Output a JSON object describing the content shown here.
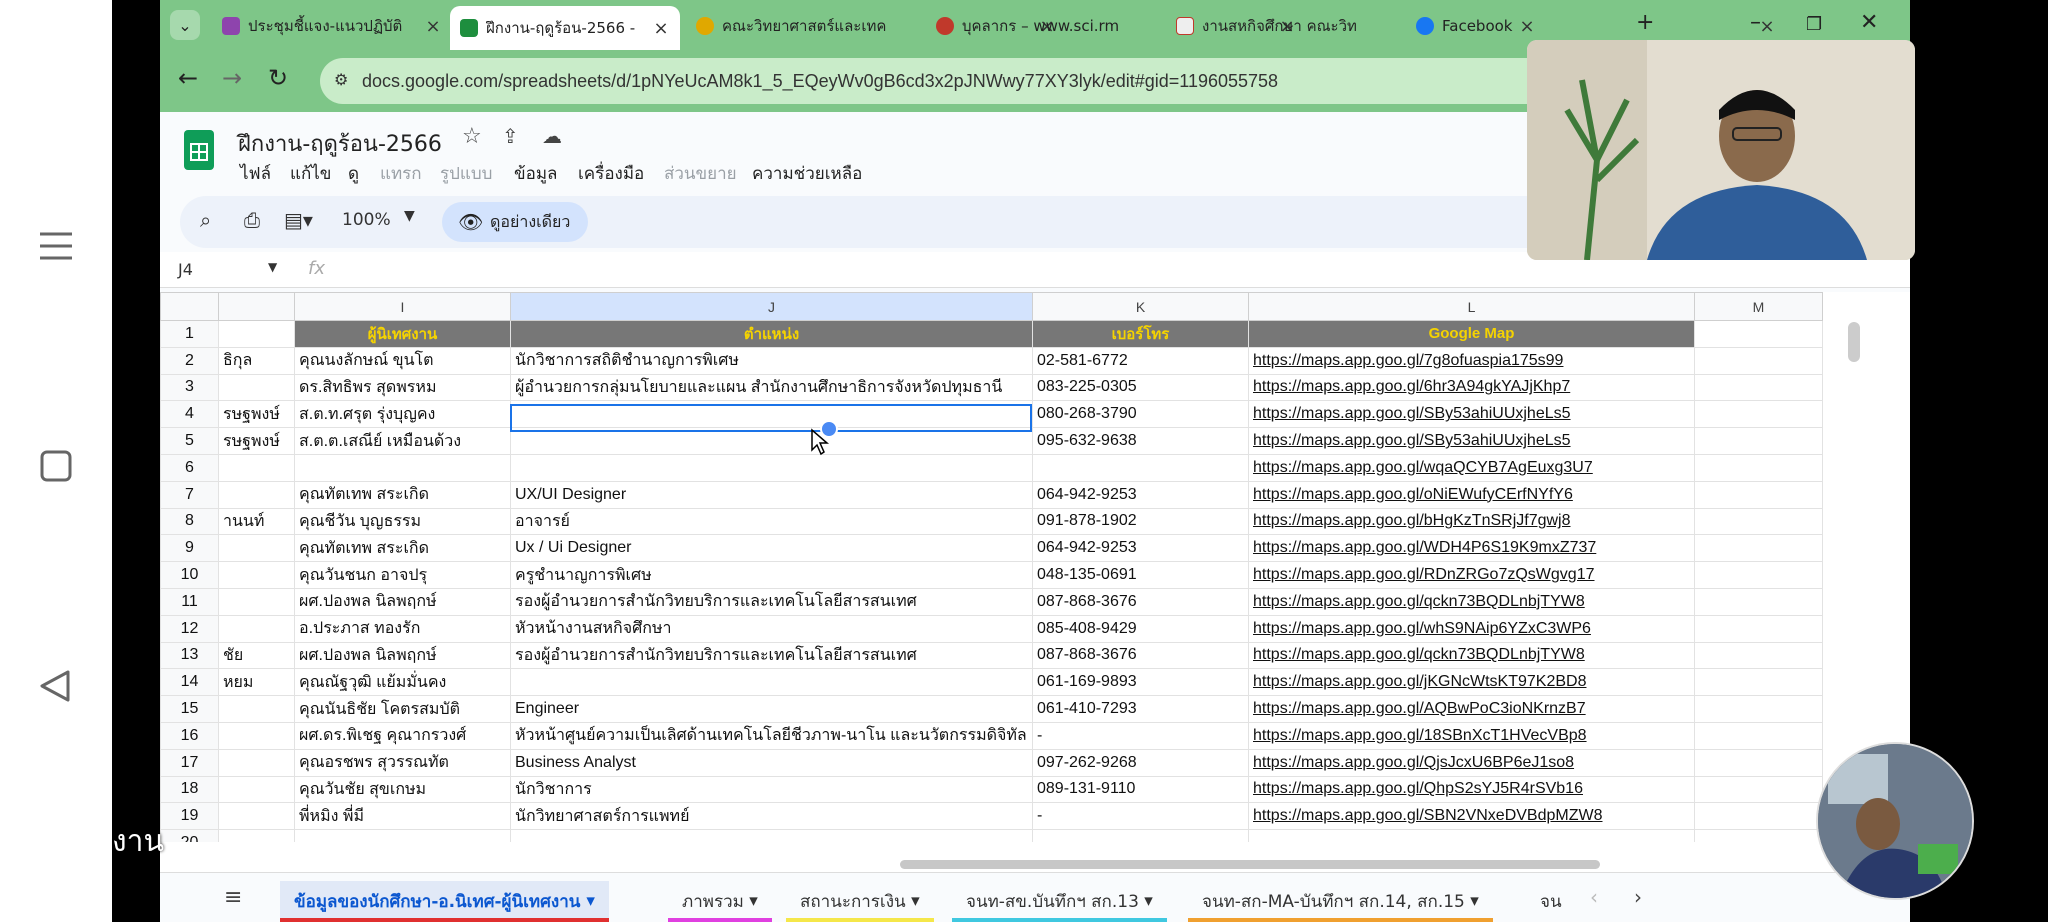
{
  "tabs": [
    "ประชุมชี้แจง-แนวปฏิบัติ",
    "ฝึกงาน-ฤดูร้อน-2566 -",
    "คณะวิทยาศาสตร์และเทค",
    "บุคลากร – www.sci.rm",
    "งานสหกิจศึกษา คณะวิท",
    "Facebook"
  ],
  "url": "docs.google.com/spreadsheets/d/1pNYeUcAM8k1_5_EQeyWv0gB6cd3x2pJNWwy77XY3lyk/edit#gid=1196055758",
  "doc": {
    "title": "ฝึกงาน-ฤดูร้อน-2566",
    "menu": [
      "ไฟล์",
      "แก้ไข",
      "ดู",
      "แทรก",
      "รูปแบบ",
      "ข้อมูล",
      "เครื่องมือ",
      "ส่วนขยาย",
      "ความช่วยเหลือ"
    ],
    "zoom": "100%",
    "view_only": "ดูอย่างเดียว",
    "namebox": "J4"
  },
  "columns": [
    "I",
    "J",
    "K",
    "L",
    "M"
  ],
  "selected_column": "J",
  "header_row": [
    "",
    "ผู้นิเทศงาน",
    "ตำแหน่ง",
    "เบอร์โทร",
    "Google Map",
    ""
  ],
  "rows": [
    {
      "n": "2",
      "h": "ธิกุล",
      "i": "คุณนงลักษณ์ ขุนโต",
      "j": "นักวิชาการสถิติชำนาญการพิเศษ",
      "k": "02-581-6772",
      "l": "https://maps.app.goo.gl/7g8ofuaspia175s99"
    },
    {
      "n": "3",
      "h": "",
      "i": "ดร.สิทธิพร สุดพรหม",
      "j": "ผู้อำนวยการกลุ่มนโยบายและแผน สำนักงานศึกษาธิการจังหวัดปทุมธานี",
      "k": "083-225-0305",
      "l": "https://maps.app.goo.gl/6hr3A94gkYAJjKhp7"
    },
    {
      "n": "4",
      "h": "รษฐพงษ์",
      "i": "ส.ต.ท.ศรุต รุ่งบุญคง",
      "j": "",
      "k": "080-268-3790",
      "l": "https://maps.app.goo.gl/SBy53ahiUUxjheLs5"
    },
    {
      "n": "5",
      "h": "รษฐพงษ์",
      "i": "ส.ต.ต.เสณีย์ เหมือนด้วง",
      "j": "",
      "k": "095-632-9638",
      "l": "https://maps.app.goo.gl/SBy53ahiUUxjheLs5"
    },
    {
      "n": "6",
      "h": "",
      "i": "",
      "j": "",
      "k": "",
      "l": "https://maps.app.goo.gl/wqaQCYB7AgEuxg3U7"
    },
    {
      "n": "7",
      "h": "",
      "i": "คุณทัตเทพ สระเกิด",
      "j": "UX/UI Designer",
      "k": "064-942-9253",
      "l": "https://maps.app.goo.gl/oNiEWufyCErfNYfY6"
    },
    {
      "n": "8",
      "h": "านนท์",
      "i": "คุณชีวัน บุญธรรม",
      "j": "อาจารย์",
      "k": "091-878-1902",
      "l": "https://maps.app.goo.gl/bHgKzTnSRjJf7gwj8"
    },
    {
      "n": "9",
      "h": "",
      "i": "คุณทัตเทพ สระเกิด",
      "j": "Ux / Ui Designer",
      "k": "064-942-9253",
      "l": "https://maps.app.goo.gl/WDH4P6S19K9mxZ737"
    },
    {
      "n": "10",
      "h": "",
      "i": "คุณวันชนก อาจปรุ",
      "j": "ครูชำนาญการพิเศษ",
      "k": "048-135-0691",
      "l": "https://maps.app.goo.gl/RDnZRGo7zQsWgvg17"
    },
    {
      "n": "11",
      "h": "",
      "i": "ผศ.ปองพล นิลพฤกษ์",
      "j": "รองผู้อำนวยการสำนักวิทยบริการและเทคโนโลยีสารสนเทศ",
      "k": "087-868-3676",
      "l": "https://maps.app.goo.gl/qckn73BQDLnbjTYW8"
    },
    {
      "n": "12",
      "h": "",
      "i": "อ.ประภาส ทองรัก",
      "j": "หัวหน้างานสหกิจศึกษา",
      "k": "085-408-9429",
      "l": "https://maps.app.goo.gl/whS9NAip6YZxC3WP6"
    },
    {
      "n": "13",
      "h": "ชัย",
      "i": "ผศ.ปองพล นิลพฤกษ์",
      "j": "รองผู้อำนวยการสำนักวิทยบริการและเทคโนโลยีสารสนเทศ",
      "k": "087-868-3676",
      "l": "https://maps.app.goo.gl/qckn73BQDLnbjTYW8"
    },
    {
      "n": "14",
      "h": "หยม",
      "i": "คุณณัฐวุฒิ แย้มมั่นคง",
      "j": "",
      "k": "061-169-9893",
      "l": "https://maps.app.goo.gl/jKGNcWtsKT97K2BD8"
    },
    {
      "n": "15",
      "h": "",
      "i": "คุณนันธิชัย โคตรสมบัติ",
      "j": "Engineer",
      "k": "061-410-7293",
      "l": "https://maps.app.goo.gl/AQBwPoC3ioNKrnzB7"
    },
    {
      "n": "16",
      "h": "",
      "i": "ผศ.ดร.พิเชฐ คุณากรวงศ์",
      "j": "หัวหน้าศูนย์ความเป็นเลิศด้านเทคโนโลยีชีวภาพ-นาโน และนวัตกรรมดิจิทัล",
      "k": "-",
      "l": "https://maps.app.goo.gl/18SBnXcT1HVecVBp8"
    },
    {
      "n": "17",
      "h": "",
      "i": "คุณอรชพร สุวรรณทัต",
      "j": "Business Analyst",
      "k": "097-262-9268",
      "l": "https://maps.app.goo.gl/QjsJcxU6BP6eJ1so8"
    },
    {
      "n": "18",
      "h": "",
      "i": "คุณวันชัย สุขเกษม",
      "j": "นักวิชาการ",
      "k": "089-131-9110",
      "l": "https://maps.app.goo.gl/QhpS2sYJ5R4rSVb16"
    },
    {
      "n": "19",
      "h": "",
      "i": "พี่หมิง พี่มี",
      "j": "นักวิทยาศาสตร์การแพทย์",
      "k": "-",
      "l": "https://maps.app.goo.gl/SBN2VNxeDVBdpMZW8"
    },
    {
      "n": "20",
      "h": "",
      "i": "",
      "j": "",
      "k": "",
      "l": ""
    }
  ],
  "sheet_tabs": [
    "ข้อมูลของนักศึกษา-อ.นิเทศ-ผู้นิเทศงาน",
    "ภาพรวม",
    "สถานะการเงิน",
    "จนท-สข.บันทึกฯ สก.13",
    "จนท-สก-MA-บันทึกฯ สก.14, สก.15",
    "จน"
  ],
  "caption": "งาน",
  "colors": {
    "tab_strip": "#7ec688",
    "header_fill": "#777777",
    "header_text": "#f5d300",
    "link": "#1155cc",
    "selection": "#1a73e8"
  }
}
